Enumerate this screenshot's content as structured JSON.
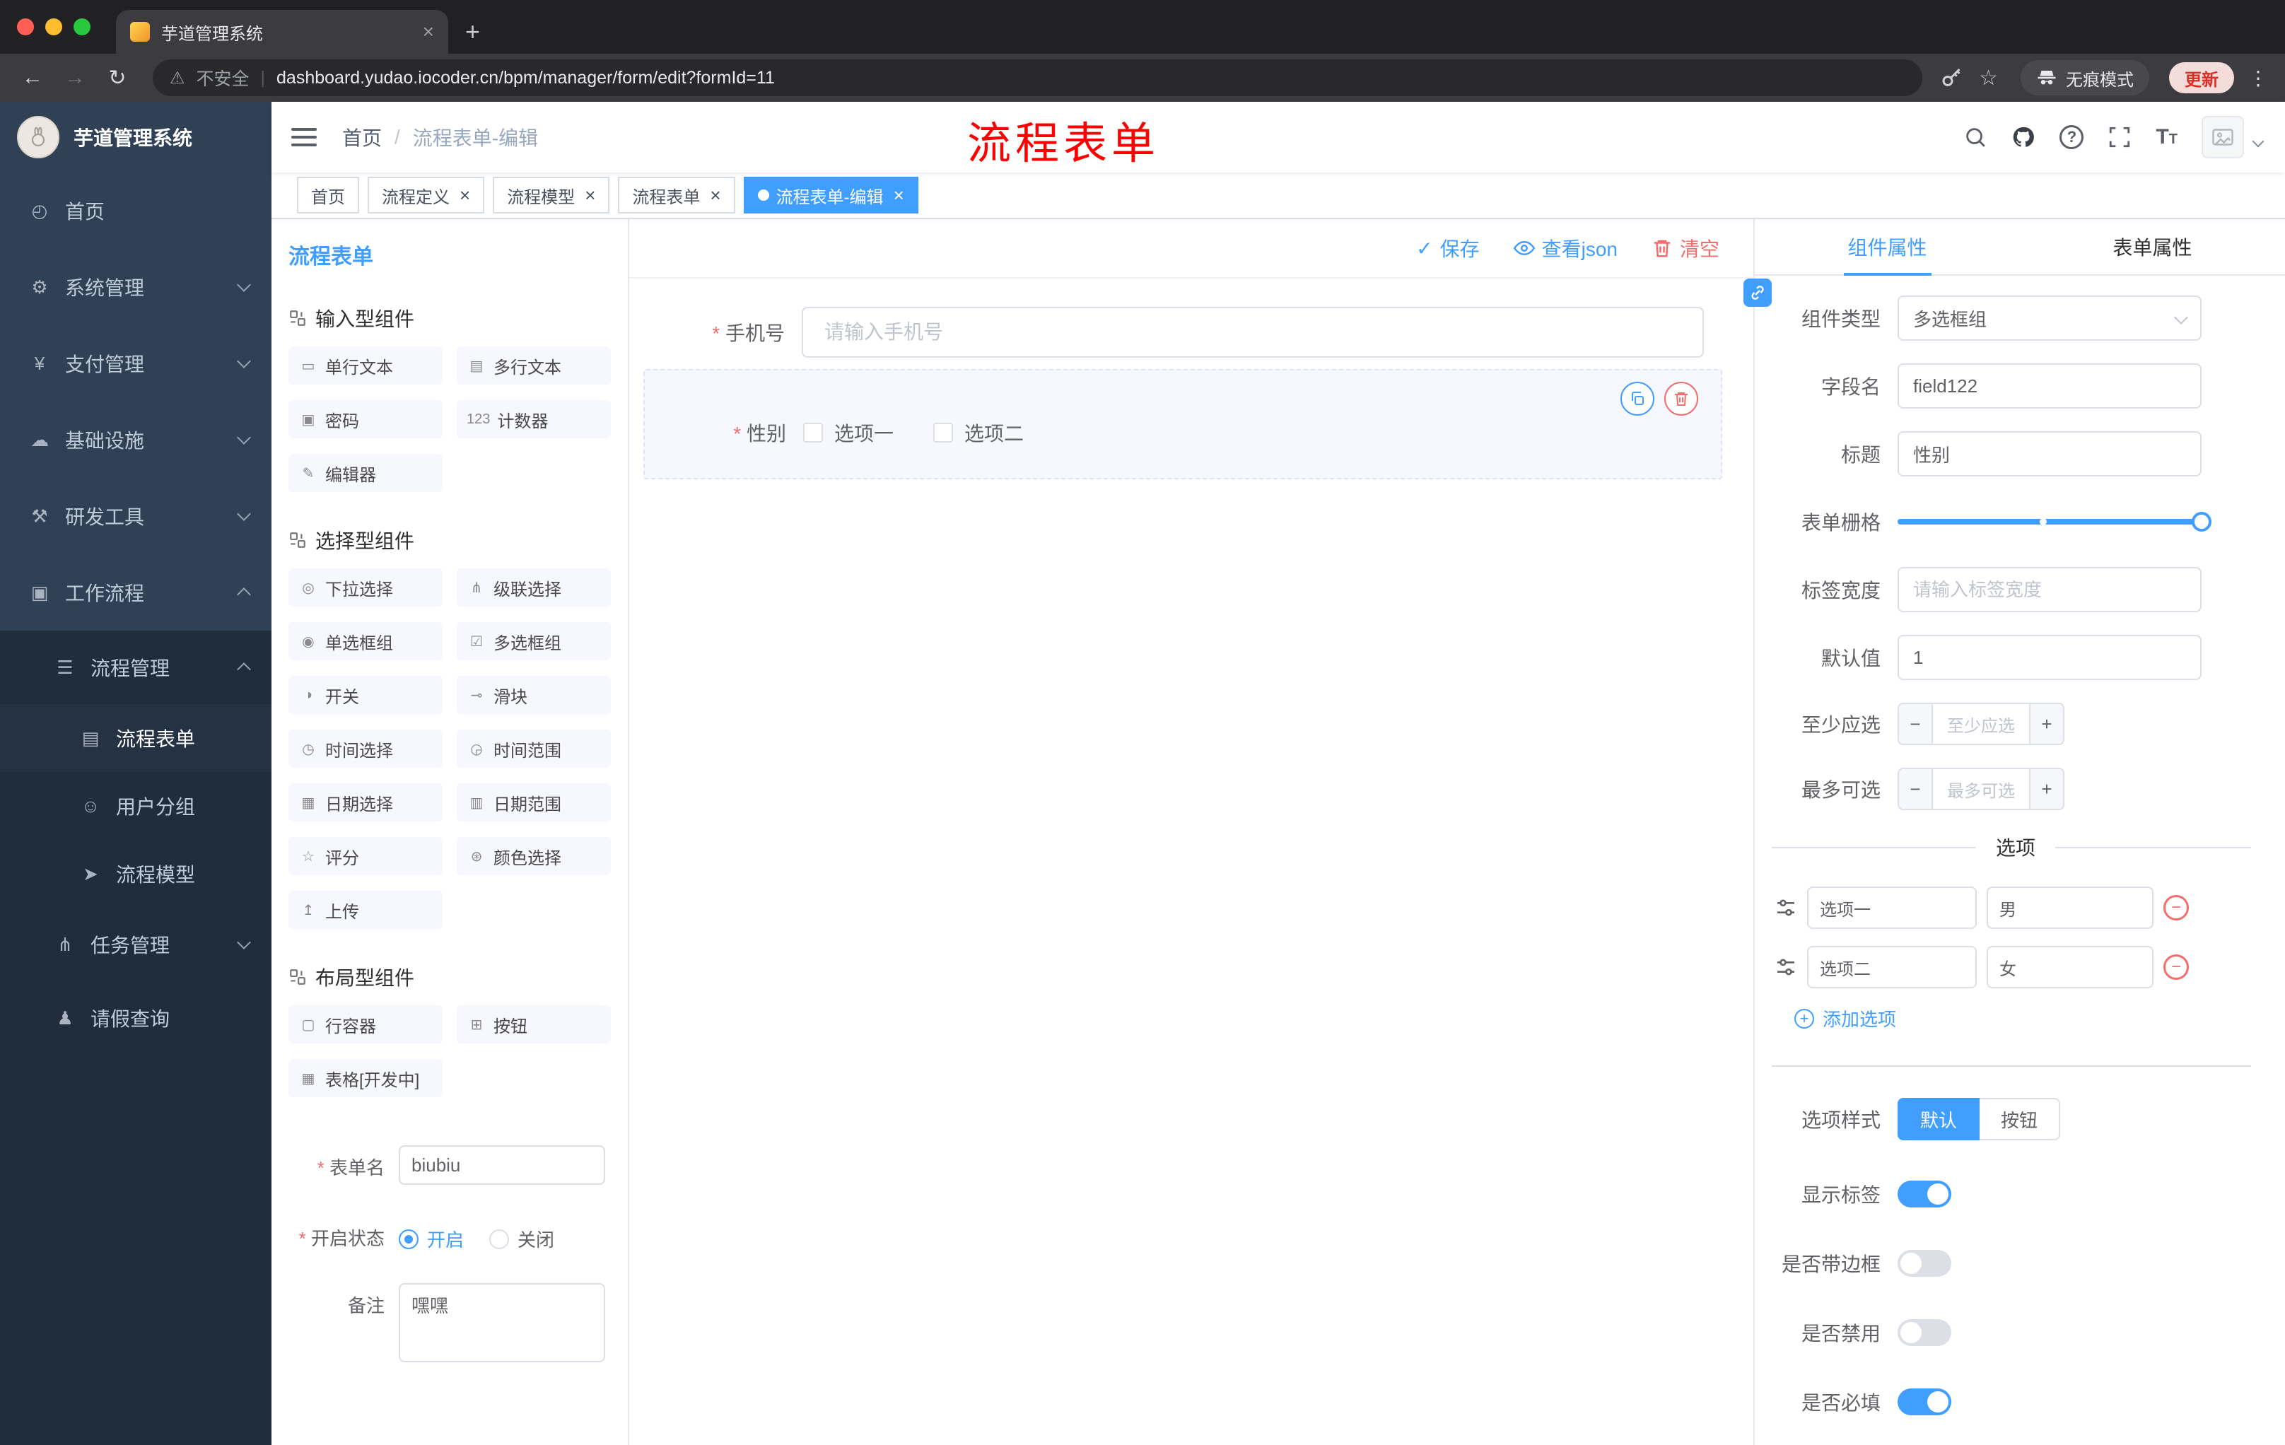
{
  "browser": {
    "tab_title": "芋道管理系统",
    "security_label": "不安全",
    "url": "dashboard.yudao.iocoder.cn/bpm/manager/form/edit?formId=11",
    "incognito_label": "无痕模式",
    "update_label": "更新"
  },
  "glyphs": {
    "close": "×",
    "plus": "+",
    "minus": "−",
    "check": "✓",
    "warning": "⚠",
    "pipe": "|",
    "kebab": "⋮",
    "star": "☆",
    "back": "←",
    "forward": "→",
    "reload": "↻",
    "slash": "/",
    "question": "?",
    "font_big": "T",
    "font_small": "T"
  },
  "sidebar": {
    "logo_title": "芋道管理系统",
    "items": [
      {
        "label": "首页",
        "icon": "◴"
      },
      {
        "label": "系统管理",
        "icon": "⚙"
      },
      {
        "label": "支付管理",
        "icon": "¥"
      },
      {
        "label": "基础设施",
        "icon": "☁"
      },
      {
        "label": "研发工具",
        "icon": "⚒"
      },
      {
        "label": "工作流程",
        "icon": "▣"
      },
      {
        "label": "流程管理",
        "icon": "☰"
      },
      {
        "label": "流程表单",
        "icon": "▤"
      },
      {
        "label": "用户分组",
        "icon": "☺"
      },
      {
        "label": "流程模型",
        "icon": "➤"
      },
      {
        "label": "任务管理",
        "icon": "⋔"
      },
      {
        "label": "请假查询",
        "icon": "♟"
      }
    ]
  },
  "header": {
    "breadcrumb": {
      "home": "首页",
      "current": "流程表单-编辑"
    },
    "annotation": "流程表单"
  },
  "tags": {
    "items": [
      {
        "label": "首页"
      },
      {
        "label": "流程定义"
      },
      {
        "label": "流程模型"
      },
      {
        "label": "流程表单"
      },
      {
        "label": "流程表单-编辑"
      }
    ]
  },
  "palette": {
    "title": "流程表单",
    "groups": [
      {
        "title": "输入型组件",
        "items": [
          {
            "label": "单行文本",
            "icon": "▭"
          },
          {
            "label": "多行文本",
            "icon": "▤"
          },
          {
            "label": "密码",
            "icon": "▣"
          },
          {
            "label": "计数器",
            "icon": "123"
          },
          {
            "label": "编辑器",
            "icon": "✎"
          }
        ]
      },
      {
        "title": "选择型组件",
        "items": [
          {
            "label": "下拉选择",
            "icon": "◎"
          },
          {
            "label": "级联选择",
            "icon": "⋔"
          },
          {
            "label": "单选框组",
            "icon": "◉"
          },
          {
            "label": "多选框组",
            "icon": "☑"
          },
          {
            "label": "开关",
            "icon": "◑"
          },
          {
            "label": "滑块",
            "icon": "⊸"
          },
          {
            "label": "时间选择",
            "icon": "◷"
          },
          {
            "label": "时间范围",
            "icon": "◶"
          },
          {
            "label": "日期选择",
            "icon": "▦"
          },
          {
            "label": "日期范围",
            "icon": "▥"
          },
          {
            "label": "评分",
            "icon": "☆"
          },
          {
            "label": "颜色选择",
            "icon": "⊛"
          },
          {
            "label": "上传",
            "icon": "↥"
          }
        ]
      },
      {
        "title": "布局型组件",
        "items": [
          {
            "label": "行容器",
            "icon": "▢"
          },
          {
            "label": "按钮",
            "icon": "⊞"
          },
          {
            "label": "表格[开发中]",
            "icon": "▦"
          }
        ]
      }
    ],
    "form": {
      "name_label": "表单名",
      "name_value": "biubiu",
      "status_label": "开启状态",
      "status_on": "开启",
      "status_off": "关闭",
      "remark_label": "备注",
      "remark_value": "嘿嘿"
    }
  },
  "canvas": {
    "toolbar": {
      "save": "保存",
      "view_json": "查看json",
      "clear": "清空"
    },
    "phone": {
      "label": "手机号",
      "placeholder": "请输入手机号"
    },
    "gender": {
      "label": "性别",
      "options": [
        {
          "label": "选项一"
        },
        {
          "label": "选项二"
        }
      ]
    }
  },
  "inspector": {
    "tabs": {
      "component": "组件属性",
      "form": "表单属性"
    },
    "component_type": {
      "label": "组件类型",
      "value": "多选框组"
    },
    "field_name": {
      "label": "字段名",
      "value": "field122"
    },
    "title": {
      "label": "标题",
      "value": "性别"
    },
    "grid": {
      "label": "表单栅格"
    },
    "label_width": {
      "label": "标签宽度",
      "placeholder": "请输入标签宽度"
    },
    "default_value": {
      "label": "默认值",
      "value": "1"
    },
    "min_select": {
      "label": "至少应选",
      "placeholder": "至少应选"
    },
    "max_select": {
      "label": "最多可选",
      "placeholder": "最多可选"
    },
    "options_title": "选项",
    "options": [
      {
        "label": "选项一",
        "value": "男"
      },
      {
        "label": "选项二",
        "value": "女"
      }
    ],
    "add_option": "添加选项",
    "option_style": {
      "label": "选项样式",
      "default": "默认",
      "button": "按钮"
    },
    "toggles": {
      "show_label": "显示标签",
      "border": "是否带边框",
      "disabled": "是否禁用",
      "required": "是否必填"
    }
  }
}
